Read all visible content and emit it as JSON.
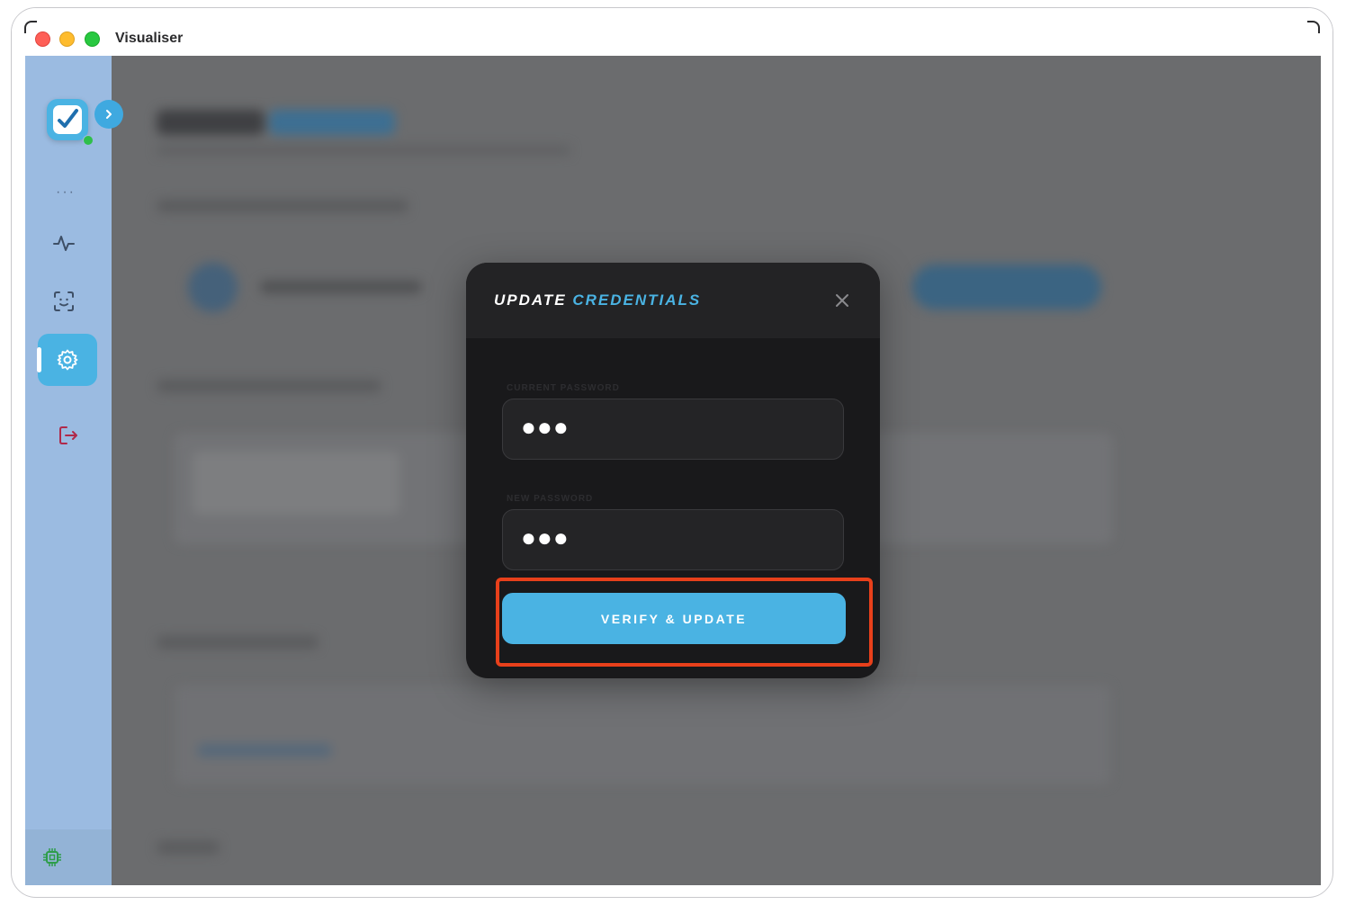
{
  "window": {
    "title": "Visualiser"
  },
  "sidebar": {
    "more_dots": "···",
    "icons": [
      "logo-icon",
      "chevron-right-icon",
      "activity-icon",
      "face-scan-icon",
      "gear-icon",
      "logout-icon",
      "chip-icon"
    ]
  },
  "modal": {
    "title_part1": "UPDATE",
    "title_part2": "CREDENTIALS",
    "current_password_label": "CURRENT PASSWORD",
    "current_password_value": "●●●",
    "new_password_label": "NEW PASSWORD",
    "new_password_value": "●●●",
    "submit_label": "VERIFY & UPDATE"
  },
  "colors": {
    "accent": "#4ab3e3",
    "modal_bg": "#19191b",
    "highlight": "#e8401b",
    "sidebar": "#9bbbe1",
    "overlay": "#6b6c6e"
  }
}
